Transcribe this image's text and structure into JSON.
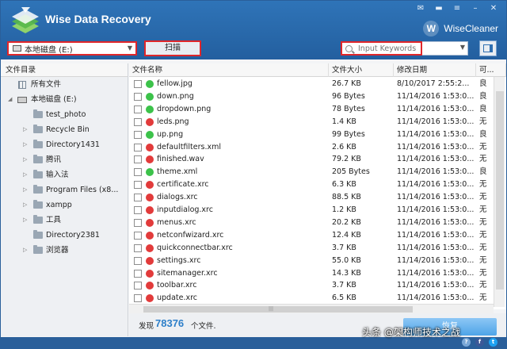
{
  "app": {
    "title": "Wise Data Recovery",
    "brand": "WiseCleaner",
    "brand_mark": "W"
  },
  "window_controls": [
    "mail-icon",
    "minimize-icon",
    "menu-icon",
    "minimize",
    "close"
  ],
  "toolbar": {
    "drive": "本地磁盘 (E:)",
    "scan_label": "扫描",
    "search_placeholder": "Input Keywords"
  },
  "sidebar": {
    "header": "文件目录",
    "all_files": "所有文件",
    "drive_label": "本地磁盘 (E:)",
    "folders": [
      {
        "label": "test_photo",
        "expandable": false
      },
      {
        "label": "Recycle Bin",
        "expandable": true
      },
      {
        "label": "Directory1431",
        "expandable": true
      },
      {
        "label": "腾讯",
        "expandable": true
      },
      {
        "label": "输入法",
        "expandable": true
      },
      {
        "label": "Program Files (x8...",
        "expandable": true
      },
      {
        "label": "xampp",
        "expandable": true
      },
      {
        "label": "工具",
        "expandable": true
      },
      {
        "label": "Directory2381",
        "expandable": false
      },
      {
        "label": "浏览器",
        "expandable": true
      }
    ]
  },
  "list": {
    "columns": [
      "文件名称",
      "文件大小",
      "修改日期",
      "可..."
    ],
    "rows": [
      {
        "name": "fellow.jpg",
        "size": "26.7 KB",
        "date": "8/10/2017 2:55:2...",
        "state": "良",
        "status": "good"
      },
      {
        "name": "down.png",
        "size": "96 Bytes",
        "date": "11/14/2016 1:53:0...",
        "state": "良",
        "status": "good"
      },
      {
        "name": "dropdown.png",
        "size": "78 Bytes",
        "date": "11/14/2016 1:53:0...",
        "state": "良",
        "status": "good"
      },
      {
        "name": "leds.png",
        "size": "1.4 KB",
        "date": "11/14/2016 1:53:0...",
        "state": "无",
        "status": "bad"
      },
      {
        "name": "up.png",
        "size": "99 Bytes",
        "date": "11/14/2016 1:53:0...",
        "state": "良",
        "status": "good"
      },
      {
        "name": "defaultfilters.xml",
        "size": "2.6 KB",
        "date": "11/14/2016 1:53:0...",
        "state": "无",
        "status": "bad"
      },
      {
        "name": "finished.wav",
        "size": "79.2 KB",
        "date": "11/14/2016 1:53:0...",
        "state": "无",
        "status": "bad"
      },
      {
        "name": "theme.xml",
        "size": "205 Bytes",
        "date": "11/14/2016 1:53:0...",
        "state": "良",
        "status": "good"
      },
      {
        "name": "certificate.xrc",
        "size": "6.3 KB",
        "date": "11/14/2016 1:53:0...",
        "state": "无",
        "status": "bad"
      },
      {
        "name": "dialogs.xrc",
        "size": "88.5 KB",
        "date": "11/14/2016 1:53:0...",
        "state": "无",
        "status": "bad"
      },
      {
        "name": "inputdialog.xrc",
        "size": "1.2 KB",
        "date": "11/14/2016 1:53:0...",
        "state": "无",
        "status": "bad"
      },
      {
        "name": "menus.xrc",
        "size": "20.2 KB",
        "date": "11/14/2016 1:53:0...",
        "state": "无",
        "status": "bad"
      },
      {
        "name": "netconfwizard.xrc",
        "size": "12.4 KB",
        "date": "11/14/2016 1:53:0...",
        "state": "无",
        "status": "bad"
      },
      {
        "name": "quickconnectbar.xrc",
        "size": "3.7 KB",
        "date": "11/14/2016 1:53:0...",
        "state": "无",
        "status": "bad"
      },
      {
        "name": "settings.xrc",
        "size": "55.0 KB",
        "date": "11/14/2016 1:53:0...",
        "state": "无",
        "status": "bad"
      },
      {
        "name": "sitemanager.xrc",
        "size": "14.3 KB",
        "date": "11/14/2016 1:53:0...",
        "state": "无",
        "status": "bad"
      },
      {
        "name": "toolbar.xrc",
        "size": "3.7 KB",
        "date": "11/14/2016 1:53:0...",
        "state": "无",
        "status": "bad"
      },
      {
        "name": "update.xrc",
        "size": "6.5 KB",
        "date": "11/14/2016 1:53:0...",
        "state": "无",
        "status": "bad"
      }
    ]
  },
  "footer": {
    "found_label": "发现",
    "found_count": "78376",
    "found_unit": "个文件.",
    "recover_label": "恢复"
  },
  "bottom_bar": {
    "icons": [
      "question-icon",
      "facebook-icon",
      "twitter-icon"
    ]
  },
  "watermark": "头条 @架构师技术之战",
  "colors": {
    "header": "#235f9f",
    "accent": "#2d7fc9",
    "highlight": "#e0262a",
    "good": "#3cc24a",
    "bad": "#e23b3b"
  }
}
